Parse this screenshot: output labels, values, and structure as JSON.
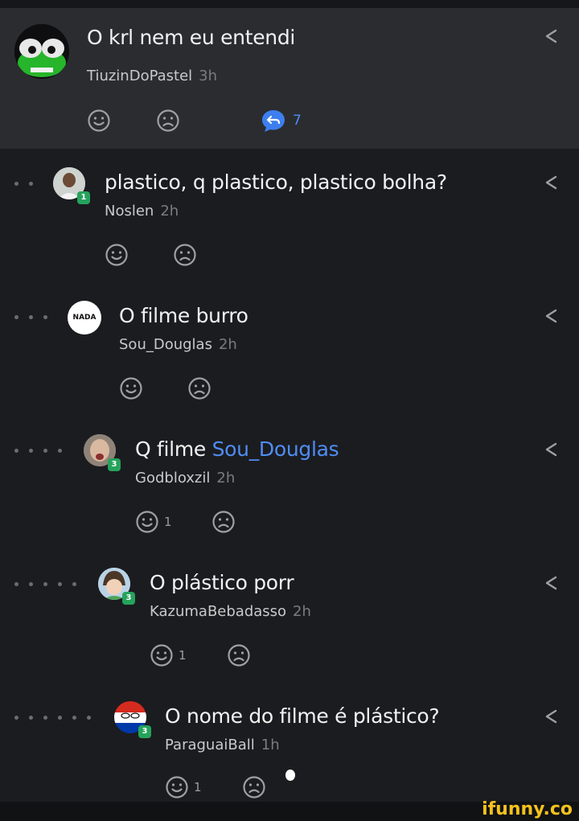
{
  "comments": [
    {
      "text": "O krl nem eu entendi",
      "user": "TiuzinDoPastel",
      "time": "3h",
      "reply_count": "7"
    },
    {
      "text": "plastico, q plastico, plastico bolha?",
      "user": "Noslen",
      "time": "2h",
      "level": "1"
    },
    {
      "text": "O filme burro",
      "user": "Sou_Douglas",
      "time": "2h",
      "avatar_text": "NADA"
    },
    {
      "text": "Q filme ",
      "mention": "Sou_Douglas",
      "user": "Godbloxzil",
      "time": "2h",
      "level": "3",
      "smile_count": "1"
    },
    {
      "text": "O plástico porr",
      "user": "KazumaBebadasso",
      "time": "2h",
      "level": "3",
      "smile_count": "1"
    },
    {
      "text": "O nome do filme é plástico?",
      "user": "ParaguaiBall",
      "time": "1h",
      "level": "3",
      "smile_count": "1"
    }
  ],
  "watermark": "ifunny.co",
  "colors": {
    "mention": "#4f8df5",
    "level_badge": "#25a35b",
    "background": "#1b1c20",
    "op_background": "#2b2c30"
  }
}
